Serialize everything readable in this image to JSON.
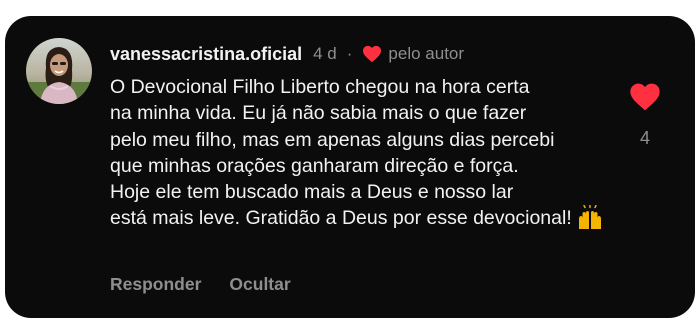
{
  "comment": {
    "username": "vanessacristina.oficial",
    "time_ago": "4 d",
    "separator": "·",
    "liked_by_author_label": "pelo autor",
    "text_lines": [
      "O Devocional Filho Liberto chegou na hora certa",
      "na minha vida. Eu já não sabia mais o que fazer",
      "pelo meu filho, mas em apenas alguns dias percebi",
      "que minhas orações ganharam direção e força.",
      "Hoje ele tem buscado mais a Deus e nosso lar",
      "está mais leve. Gratidão a Deus por esse devocional!"
    ],
    "trailing_emoji": "raising-hands-emoji",
    "actions": {
      "reply_label": "Responder",
      "hide_label": "Ocultar"
    },
    "like_count": "4"
  },
  "colors": {
    "background": "#0b0b0b",
    "text_primary": "#f2f2f2",
    "text_secondary": "#8e8e8e",
    "heart": "#ff3040"
  }
}
